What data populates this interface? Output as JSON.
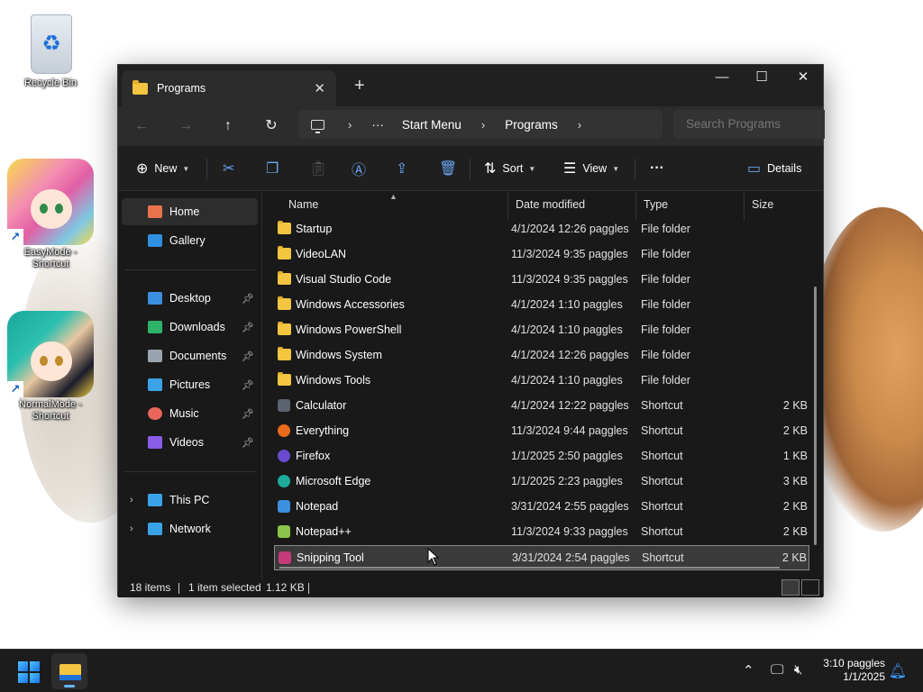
{
  "desktop": {
    "icons": [
      {
        "label": "Recycle Bin"
      },
      {
        "label": "EasyMode - Shortcut"
      },
      {
        "label": "NormalMode - Shortcut"
      }
    ]
  },
  "window": {
    "tab_title": "Programs",
    "new_tab": "+",
    "controls": {
      "minimize": "—",
      "maximize": "☐",
      "close": "✕"
    }
  },
  "navbar": {
    "back": "←",
    "forward": "→",
    "up": "↑",
    "refresh": "↻",
    "more": "···",
    "breadcrumbs": [
      "Start Menu",
      "Programs"
    ],
    "search_placeholder": "Search Programs"
  },
  "toolbar": {
    "new_label": "New",
    "sort_label": "Sort",
    "view_label": "View",
    "more": "···",
    "details_label": "Details"
  },
  "sidebar": {
    "top": [
      {
        "label": "Home",
        "icon": "home-icon",
        "color": "#e8734a"
      },
      {
        "label": "Gallery",
        "icon": "gallery-icon",
        "color": "#2f8fe0"
      }
    ],
    "quick": [
      {
        "label": "Desktop",
        "icon": "desktop-icon",
        "color": "#3b8fe0"
      },
      {
        "label": "Downloads",
        "icon": "downloads-icon",
        "color": "#2fb36a"
      },
      {
        "label": "Documents",
        "icon": "documents-icon",
        "color": "#9aa4ae"
      },
      {
        "label": "Pictures",
        "icon": "pictures-icon",
        "color": "#3aa3e8"
      },
      {
        "label": "Music",
        "icon": "music-icon",
        "color": "#e8665a"
      },
      {
        "label": "Videos",
        "icon": "videos-icon",
        "color": "#8b5ce8"
      }
    ],
    "devices": [
      {
        "label": "This PC",
        "icon": "this-pc-icon",
        "color": "#3aa3e8"
      },
      {
        "label": "Network",
        "icon": "network-icon",
        "color": "#3aa3e8"
      }
    ]
  },
  "columns": [
    "Name",
    "Date modified",
    "Type",
    "Size"
  ],
  "files": [
    {
      "name": "Startup",
      "date": "4/1/2024 12:26 paggles",
      "type": "File folder",
      "size": "",
      "icon": "folder-icon",
      "kind": "folder"
    },
    {
      "name": "VideoLAN",
      "date": "11/3/2024 9:35 paggles",
      "type": "File folder",
      "size": "",
      "icon": "folder-icon",
      "kind": "folder"
    },
    {
      "name": "Visual Studio Code",
      "date": "11/3/2024 9:35 paggles",
      "type": "File folder",
      "size": "",
      "icon": "folder-icon",
      "kind": "folder"
    },
    {
      "name": "Windows Accessories",
      "date": "4/1/2024 1:10 paggles",
      "type": "File folder",
      "size": "",
      "icon": "folder-icon",
      "kind": "folder"
    },
    {
      "name": "Windows PowerShell",
      "date": "4/1/2024 1:10 paggles",
      "type": "File folder",
      "size": "",
      "icon": "folder-icon",
      "kind": "folder"
    },
    {
      "name": "Windows System",
      "date": "4/1/2024 12:26 paggles",
      "type": "File folder",
      "size": "",
      "icon": "folder-icon",
      "kind": "folder"
    },
    {
      "name": "Windows Tools",
      "date": "4/1/2024 1:10 paggles",
      "type": "File folder",
      "size": "",
      "icon": "folder-icon",
      "kind": "folder"
    },
    {
      "name": "Calculator",
      "date": "4/1/2024 12:22 paggles",
      "type": "Shortcut",
      "size": "2 KB",
      "icon": "calculator-icon",
      "kind": "app",
      "color": "#5a6470"
    },
    {
      "name": "Everything",
      "date": "11/3/2024 9:44 paggles",
      "type": "Shortcut",
      "size": "2 KB",
      "icon": "everything-icon",
      "kind": "app",
      "color": "#e86a1a"
    },
    {
      "name": "Firefox",
      "date": "1/1/2025 2:50 paggles",
      "type": "Shortcut",
      "size": "1 KB",
      "icon": "firefox-icon",
      "kind": "app",
      "color": "#6a4ad0"
    },
    {
      "name": "Microsoft Edge",
      "date": "1/1/2025 2:23 paggles",
      "type": "Shortcut",
      "size": "3 KB",
      "icon": "edge-icon",
      "kind": "app",
      "color": "#1eaa9a"
    },
    {
      "name": "Notepad",
      "date": "3/31/2024 2:55 paggles",
      "type": "Shortcut",
      "size": "2 KB",
      "icon": "notepad-icon",
      "kind": "app",
      "color": "#3a8fe0"
    },
    {
      "name": "Notepad++",
      "date": "11/3/2024 9:33 paggles",
      "type": "Shortcut",
      "size": "2 KB",
      "icon": "notepadpp-icon",
      "kind": "app",
      "color": "#8bc34a"
    },
    {
      "name": "Snipping Tool",
      "date": "3/31/2024 2:54 paggles",
      "type": "Shortcut",
      "size": "2 KB",
      "icon": "snipping-tool-icon",
      "kind": "app",
      "color": "#c43a7a",
      "selected": true
    }
  ],
  "status": {
    "items": "18 items",
    "selected": "1 item selected",
    "size": "1.12 KB"
  },
  "taskbar": {
    "time": "3:10 paggles",
    "date": "1/1/2025"
  }
}
